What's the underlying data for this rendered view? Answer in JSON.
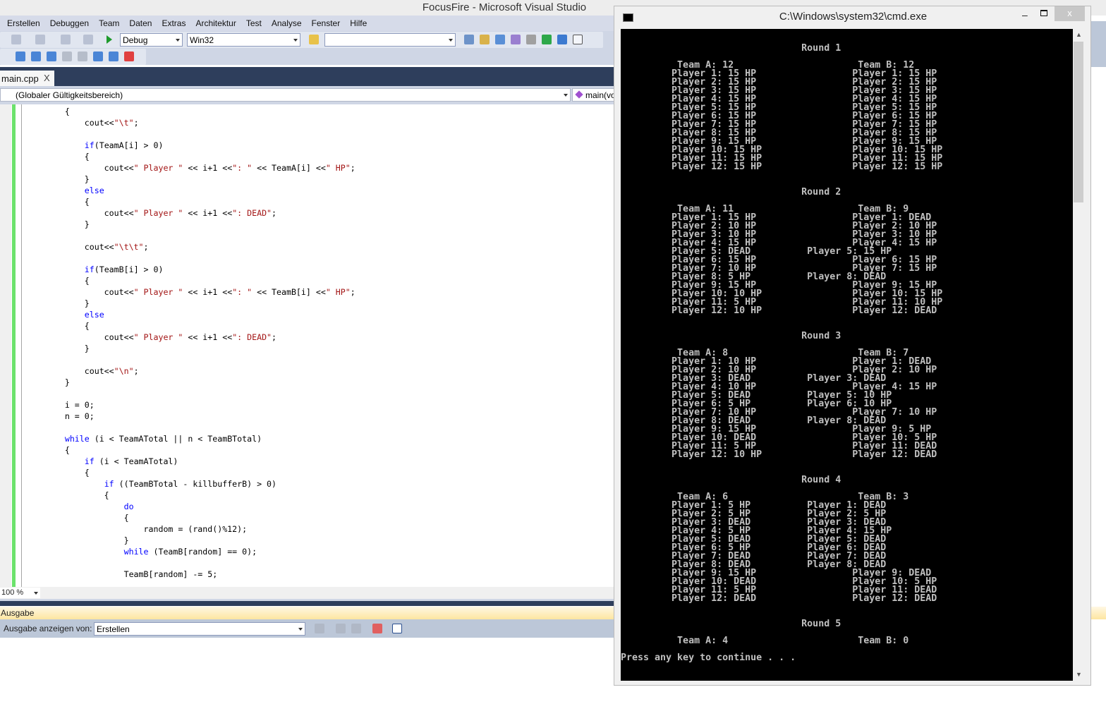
{
  "vs": {
    "title": "FocusFire - Microsoft Visual Studio",
    "menu": [
      "Erstellen",
      "Debuggen",
      "Team",
      "Daten",
      "Extras",
      "Architektur",
      "Test",
      "Analyse",
      "Fenster",
      "Hilfe"
    ],
    "config": "Debug",
    "platform": "Win32",
    "find": "",
    "tab": "main.cpp",
    "tab_close": "X",
    "scope": "(Globaler Gültigkeitsbereich)",
    "member": "main(vo",
    "zoom": "100 %",
    "output_title": "Ausgabe",
    "output_from_label": "Ausgabe anzeigen von:",
    "output_from": "Erstellen",
    "colors": {
      "keyword": "#0000ff",
      "string": "#a31515",
      "changebar": "#6ce26c",
      "console_text": "#c0c0c0"
    },
    "code": [
      [
        [
          "p",
          "        {"
        ]
      ],
      [
        [
          "p",
          "            cout<<"
        ],
        [
          "s",
          "\"\\t\""
        ],
        [
          "p",
          ";"
        ]
      ],
      [
        [
          "p",
          ""
        ]
      ],
      [
        [
          "p",
          "            "
        ],
        [
          "k",
          "if"
        ],
        [
          "p",
          "(TeamA[i] > 0)"
        ]
      ],
      [
        [
          "p",
          "            {"
        ]
      ],
      [
        [
          "p",
          "                cout<<"
        ],
        [
          "s",
          "\" Player \""
        ],
        [
          "p",
          " << i+1 <<"
        ],
        [
          "s",
          "\": \""
        ],
        [
          "p",
          " << TeamA[i] <<"
        ],
        [
          "s",
          "\" HP\""
        ],
        [
          "p",
          ";"
        ]
      ],
      [
        [
          "p",
          "            }"
        ]
      ],
      [
        [
          "p",
          "            "
        ],
        [
          "k",
          "else"
        ]
      ],
      [
        [
          "p",
          "            {"
        ]
      ],
      [
        [
          "p",
          "                cout<<"
        ],
        [
          "s",
          "\" Player \""
        ],
        [
          "p",
          " << i+1 <<"
        ],
        [
          "s",
          "\": DEAD\""
        ],
        [
          "p",
          ";"
        ]
      ],
      [
        [
          "p",
          "            }"
        ]
      ],
      [
        [
          "p",
          ""
        ]
      ],
      [
        [
          "p",
          "            cout<<"
        ],
        [
          "s",
          "\"\\t\\t\""
        ],
        [
          "p",
          ";"
        ]
      ],
      [
        [
          "p",
          ""
        ]
      ],
      [
        [
          "p",
          "            "
        ],
        [
          "k",
          "if"
        ],
        [
          "p",
          "(TeamB[i] > 0)"
        ]
      ],
      [
        [
          "p",
          "            {"
        ]
      ],
      [
        [
          "p",
          "                cout<<"
        ],
        [
          "s",
          "\" Player \""
        ],
        [
          "p",
          " << i+1 <<"
        ],
        [
          "s",
          "\": \""
        ],
        [
          "p",
          " << TeamB[i] <<"
        ],
        [
          "s",
          "\" HP\""
        ],
        [
          "p",
          ";"
        ]
      ],
      [
        [
          "p",
          "            }"
        ]
      ],
      [
        [
          "p",
          "            "
        ],
        [
          "k",
          "else"
        ]
      ],
      [
        [
          "p",
          "            {"
        ]
      ],
      [
        [
          "p",
          "                cout<<"
        ],
        [
          "s",
          "\" Player \""
        ],
        [
          "p",
          " << i+1 <<"
        ],
        [
          "s",
          "\": DEAD\""
        ],
        [
          "p",
          ";"
        ]
      ],
      [
        [
          "p",
          "            }"
        ]
      ],
      [
        [
          "p",
          ""
        ]
      ],
      [
        [
          "p",
          "            cout<<"
        ],
        [
          "s",
          "\"\\n\""
        ],
        [
          "p",
          ";"
        ]
      ],
      [
        [
          "p",
          "        }"
        ]
      ],
      [
        [
          "p",
          ""
        ]
      ],
      [
        [
          "p",
          "        i = 0;"
        ]
      ],
      [
        [
          "p",
          "        n = 0;"
        ]
      ],
      [
        [
          "p",
          ""
        ]
      ],
      [
        [
          "p",
          "        "
        ],
        [
          "k",
          "while"
        ],
        [
          "p",
          " (i < TeamATotal || n < TeamBTotal)"
        ]
      ],
      [
        [
          "p",
          "        {"
        ]
      ],
      [
        [
          "p",
          "            "
        ],
        [
          "k",
          "if"
        ],
        [
          "p",
          " (i < TeamATotal)"
        ]
      ],
      [
        [
          "p",
          "            {"
        ]
      ],
      [
        [
          "p",
          "                "
        ],
        [
          "k",
          "if"
        ],
        [
          "p",
          " ((TeamBTotal - killbufferB) > 0)"
        ]
      ],
      [
        [
          "p",
          "                {"
        ]
      ],
      [
        [
          "p",
          "                    "
        ],
        [
          "k",
          "do"
        ]
      ],
      [
        [
          "p",
          "                    {"
        ]
      ],
      [
        [
          "p",
          "                        random = (rand()%12);"
        ]
      ],
      [
        [
          "p",
          "                    }"
        ]
      ],
      [
        [
          "p",
          "                    "
        ],
        [
          "k",
          "while"
        ],
        [
          "p",
          " (TeamB[random] == 0);"
        ]
      ],
      [
        [
          "p",
          ""
        ]
      ],
      [
        [
          "p",
          "                    TeamB[random] -= 5;"
        ]
      ]
    ]
  },
  "cmd": {
    "title": "C:\\Windows\\system32\\cmd.exe",
    "close": "x",
    "prompt": "Press any key to continue . . .",
    "rounds": [
      {
        "label": "Round 1",
        "team_a": "Team A: 12",
        "team_b": "Team B: 12",
        "a": [
          "Player 1: 15 HP",
          "Player 2: 15 HP",
          "Player 3: 15 HP",
          "Player 4: 15 HP",
          "Player 5: 15 HP",
          "Player 6: 15 HP",
          "Player 7: 15 HP",
          "Player 8: 15 HP",
          "Player 9: 15 HP",
          "Player 10: 15 HP",
          "Player 11: 15 HP",
          "Player 12: 15 HP"
        ],
        "b": [
          "Player 1: 15 HP",
          "Player 2: 15 HP",
          "Player 3: 15 HP",
          "Player 4: 15 HP",
          "Player 5: 15 HP",
          "Player 6: 15 HP",
          "Player 7: 15 HP",
          "Player 8: 15 HP",
          "Player 9: 15 HP",
          "Player 10: 15 HP",
          "Player 11: 15 HP",
          "Player 12: 15 HP"
        ]
      },
      {
        "label": "Round 2",
        "team_a": "Team A: 11",
        "team_b": "Team B: 9",
        "a": [
          "Player 1: 15 HP",
          "Player 2: 10 HP",
          "Player 3: 10 HP",
          "Player 4: 15 HP",
          "Player 5: DEAD",
          "Player 6: 15 HP",
          "Player 7: 10 HP",
          "Player 8: 5 HP",
          "Player 9: 15 HP",
          "Player 10: 10 HP",
          "Player 11: 5 HP",
          "Player 12: 10 HP"
        ],
        "b": [
          "Player 1: DEAD",
          "Player 2: 10 HP",
          "Player 3: 10 HP",
          "Player 4: 15 HP",
          "Player 5: 15 HP",
          "Player 6: 15 HP",
          "Player 7: 15 HP",
          "Player 8: DEAD",
          "Player 9: 15 HP",
          "Player 10: 15 HP",
          "Player 11: 10 HP",
          "Player 12: DEAD"
        ]
      },
      {
        "label": "Round 3",
        "team_a": "Team A: 8",
        "team_b": "Team B: 7",
        "a": [
          "Player 1: 10 HP",
          "Player 2: 10 HP",
          "Player 3: DEAD",
          "Player 4: 10 HP",
          "Player 5: DEAD",
          "Player 6: 5 HP",
          "Player 7: 10 HP",
          "Player 8: DEAD",
          "Player 9: 15 HP",
          "Player 10: DEAD",
          "Player 11: 5 HP",
          "Player 12: 10 HP"
        ],
        "b": [
          "Player 1: DEAD",
          "Player 2: 10 HP",
          "Player 3: DEAD",
          "Player 4: 15 HP",
          "Player 5: 10 HP",
          "Player 6: 10 HP",
          "Player 7: 10 HP",
          "Player 8: DEAD",
          "Player 9: 5 HP",
          "Player 10: 5 HP",
          "Player 11: DEAD",
          "Player 12: DEAD"
        ]
      },
      {
        "label": "Round 4",
        "team_a": "Team A: 6",
        "team_b": "Team B: 3",
        "a": [
          "Player 1: 5 HP",
          "Player 2: 5 HP",
          "Player 3: DEAD",
          "Player 4: 5 HP",
          "Player 5: DEAD",
          "Player 6: 5 HP",
          "Player 7: DEAD",
          "Player 8: DEAD",
          "Player 9: 15 HP",
          "Player 10: DEAD",
          "Player 11: 5 HP",
          "Player 12: DEAD"
        ],
        "b": [
          "Player 1: DEAD",
          "Player 2: 5 HP",
          "Player 3: DEAD",
          "Player 4: 15 HP",
          "Player 5: DEAD",
          "Player 6: DEAD",
          "Player 7: DEAD",
          "Player 8: DEAD",
          "Player 9: DEAD",
          "Player 10: 5 HP",
          "Player 11: DEAD",
          "Player 12: DEAD"
        ]
      },
      {
        "label": "Round 5",
        "team_a": "Team A: 4",
        "team_b": "Team B: 0",
        "a": [],
        "b": []
      }
    ]
  }
}
